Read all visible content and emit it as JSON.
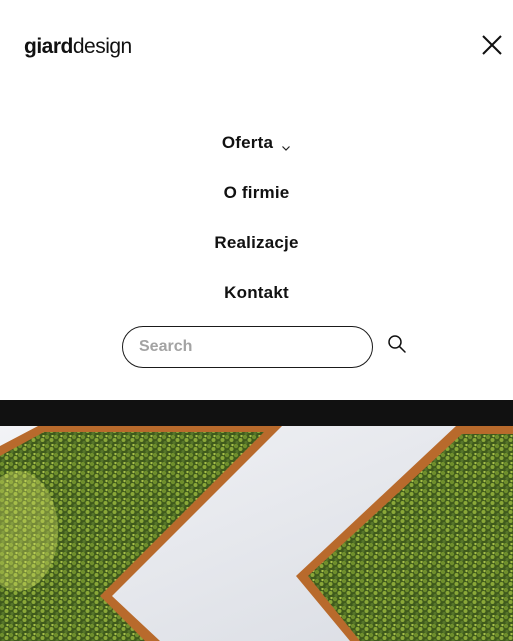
{
  "logo": {
    "bold": "giard",
    "light": "design"
  },
  "nav": {
    "items": [
      {
        "label": "Oferta",
        "has_dropdown": true
      },
      {
        "label": "O firmie"
      },
      {
        "label": "Realizacje"
      },
      {
        "label": "Kontakt"
      }
    ]
  },
  "search": {
    "placeholder": "Search",
    "value": ""
  },
  "icons": {
    "close": "close-icon",
    "search": "search-icon",
    "chevron": "chevron-down-icon"
  },
  "colors": {
    "text": "#111111",
    "dark_bar": "#111111",
    "wall": "#e7e9ee",
    "wood": "#b86a2c",
    "moss": "#4f6f22"
  }
}
